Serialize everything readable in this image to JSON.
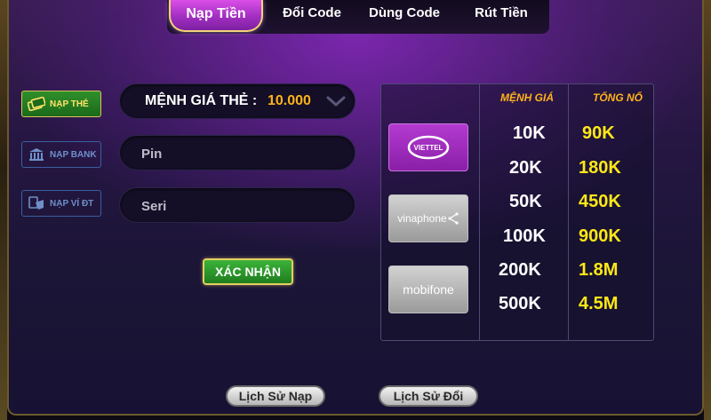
{
  "tabs": [
    {
      "label": "Nạp Tiền",
      "active": true
    },
    {
      "label": "Đổi Code",
      "active": false
    },
    {
      "label": "Dùng Code",
      "active": false
    },
    {
      "label": "Rút Tiền",
      "active": false
    }
  ],
  "side_menu": [
    {
      "label": "NẠP THẺ",
      "icon": "card-icon",
      "active": true
    },
    {
      "label": "NẠP BANK",
      "icon": "bank-icon",
      "active": false
    },
    {
      "label": "NẠP VÍ ĐT",
      "icon": "wallet-icon",
      "active": false
    }
  ],
  "form": {
    "denomination_label": "MỆNH GIÁ THẺ :",
    "denomination_value": "10.000",
    "pin_placeholder": "Pin",
    "seri_placeholder": "Seri",
    "confirm_label": "XÁC NHẬN"
  },
  "networks": [
    {
      "name": "VIETTEL"
    },
    {
      "name": "vinaphone"
    },
    {
      "name": "mobifone"
    }
  ],
  "rates": {
    "headers": [
      "MỆNH GIÁ",
      "TỔNG NỔ"
    ],
    "rows": [
      {
        "value": "10K",
        "bonus": "90K"
      },
      {
        "value": "20K",
        "bonus": "180K"
      },
      {
        "value": "50K",
        "bonus": "450K"
      },
      {
        "value": "100K",
        "bonus": "900K"
      },
      {
        "value": "200K",
        "bonus": "1.8M"
      },
      {
        "value": "500K",
        "bonus": "4.5M"
      }
    ]
  },
  "footer": {
    "history_topup": "Lịch Sử Nạp",
    "history_exchange": "Lịch Sử Đổi"
  },
  "colors": {
    "accent_gold": "#ffb21a",
    "bonus_yellow": "#ffe817",
    "active_tab": "#a22fc2",
    "active_green": "#2f8f2a"
  }
}
